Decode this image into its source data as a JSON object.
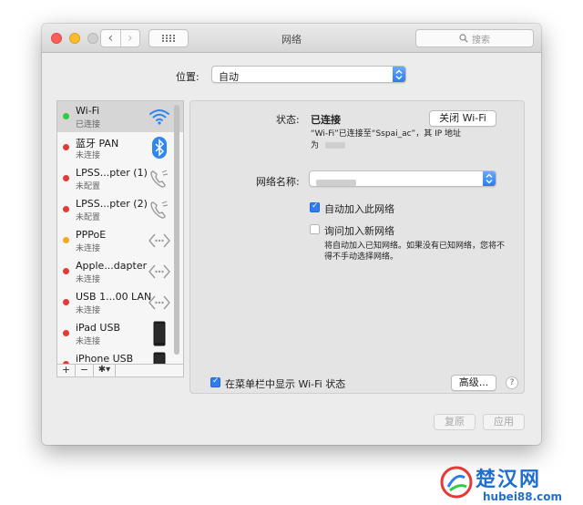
{
  "window": {
    "title": "网络",
    "search_placeholder": "搜索"
  },
  "location": {
    "label": "位置:",
    "value": "自动"
  },
  "services": [
    {
      "name": "Wi-Fi",
      "status": "已连接",
      "color": "#2ecc40",
      "icon": "wifi-icon"
    },
    {
      "name": "蓝牙 PAN",
      "status": "未连接",
      "color": "#e53935",
      "icon": "bluetooth-icon"
    },
    {
      "name": "LPSS...pter (1)",
      "status": "未配置",
      "color": "#e53935",
      "icon": "phone-icon"
    },
    {
      "name": "LPSS...pter (2)",
      "status": "未配置",
      "color": "#e53935",
      "icon": "phone-icon"
    },
    {
      "name": "PPPoE",
      "status": "未连接",
      "color": "#f5a623",
      "icon": "ethernet-icon"
    },
    {
      "name": "Apple...dapter",
      "status": "未连接",
      "color": "#e53935",
      "icon": "ethernet-icon"
    },
    {
      "name": "USB 1...00 LAN",
      "status": "未连接",
      "color": "#e53935",
      "icon": "ethernet-icon"
    },
    {
      "name": "iPad USB",
      "status": "未连接",
      "color": "#e53935",
      "icon": "device-icon"
    },
    {
      "name": "iPhone USB",
      "status": "未连接",
      "color": "#e53935",
      "icon": "device-icon"
    }
  ],
  "toolbar": {
    "add": "+",
    "remove": "−",
    "gear": "✱▾"
  },
  "detail": {
    "status_label": "状态:",
    "status_value": "已连接",
    "turn_off_wifi": "关闭 Wi-Fi",
    "status_desc_line1": "“Wi-Fi”已连接至“Sspai_ac”，其 IP 地址",
    "status_desc_line2": "为",
    "network_name_label": "网络名称:",
    "auto_join_label": "自动加入此网络",
    "auto_join_checked": true,
    "ask_join_label": "询问加入新网络",
    "ask_join_checked": false,
    "ask_join_desc_line1": "将自动加入已知网络。如果没有已知网络，您将不",
    "ask_join_desc_line2": "得不手动选择网络。",
    "menubar_label": "在菜单栏中显示 Wi-Fi 状态",
    "menubar_checked": true,
    "advanced_button": "高级...",
    "help": "?"
  },
  "footer": {
    "revert": "复原",
    "apply": "应用"
  },
  "watermark": {
    "title": "楚汉网",
    "url": "hubei88.com"
  },
  "colors": {
    "accent": "#2f7df5",
    "selection": "#d6d6d6"
  }
}
